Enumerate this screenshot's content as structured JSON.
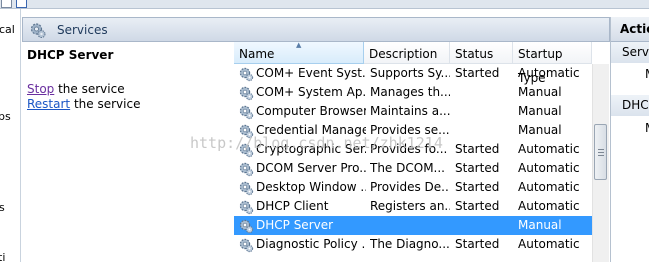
{
  "left_tree": {
    "fragments": [
      {
        "text": "cal"
      },
      {
        "text": "ps"
      },
      {
        "text": "s"
      },
      {
        "text": "ti"
      }
    ]
  },
  "services_header": {
    "title": "Services",
    "icon": "gear-icon"
  },
  "extended_panel": {
    "service_name": "DHCP Server",
    "stop_link": "Stop",
    "stop_suffix": " the service",
    "restart_link": "Restart",
    "restart_suffix": " the service"
  },
  "list": {
    "columns": [
      "Name",
      "Description",
      "Status",
      "Startup Type"
    ],
    "rows": [
      {
        "name": "COM+ Event Syst...",
        "description": "Supports Sy...",
        "status": "Started",
        "startup": "Automatic"
      },
      {
        "name": "COM+ System Ap...",
        "description": "Manages th...",
        "status": "",
        "startup": "Manual"
      },
      {
        "name": "Computer Browser",
        "description": "Maintains a...",
        "status": "",
        "startup": "Manual"
      },
      {
        "name": "Credential Manager",
        "description": "Provides se...",
        "status": "",
        "startup": "Manual"
      },
      {
        "name": "Cryptographic Ser...",
        "description": "Provides fo...",
        "status": "Started",
        "startup": "Automatic"
      },
      {
        "name": "DCOM Server Pro...",
        "description": "The DCOM...",
        "status": "Started",
        "startup": "Automatic"
      },
      {
        "name": "Desktop Window ...",
        "description": "Provides De...",
        "status": "Started",
        "startup": "Automatic"
      },
      {
        "name": "DHCP Client",
        "description": "Registers an...",
        "status": "Started",
        "startup": "Automatic"
      },
      {
        "name": "DHCP Server",
        "description": "",
        "status": "",
        "startup": "Manual"
      },
      {
        "name": "Diagnostic Policy ...",
        "description": "The Diagno...",
        "status": "Started",
        "startup": "Automatic"
      }
    ],
    "selected_index": 8
  },
  "actions_pane": {
    "title": "Actio",
    "section1": "Servic",
    "item1": "M",
    "section2": "DHCP",
    "item2": "M"
  },
  "watermark": "http://blog.csdn.net/zhk1214",
  "colors": {
    "selection": "#3399ff",
    "link": "#1a56c5",
    "visited_link": "#6a2f9f",
    "header_text": "#1e395b"
  }
}
